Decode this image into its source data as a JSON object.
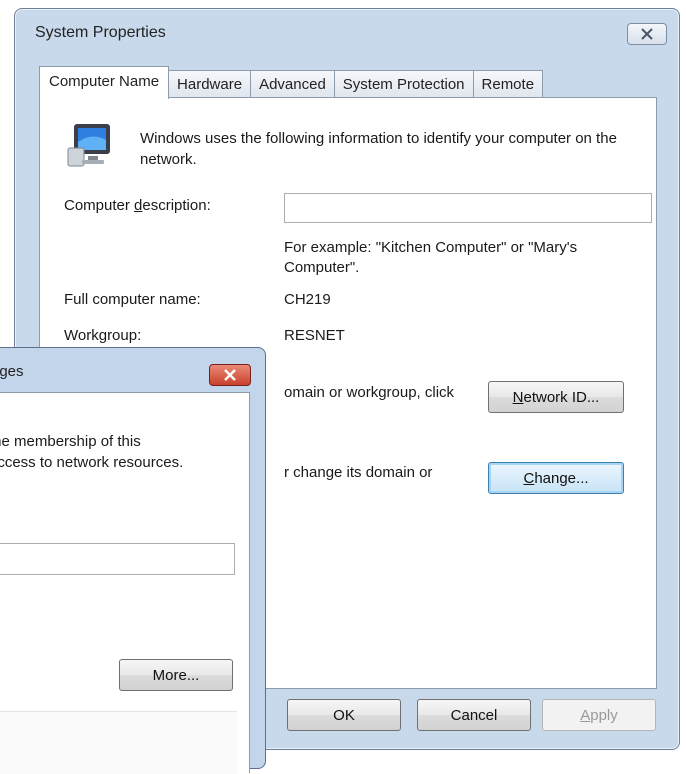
{
  "window": {
    "title": "System Properties",
    "tabs": [
      {
        "label": "Computer Name",
        "active": true
      },
      {
        "label": "Hardware",
        "active": false
      },
      {
        "label": "Advanced",
        "active": false
      },
      {
        "label": "System Protection",
        "active": false
      },
      {
        "label": "Remote",
        "active": false
      }
    ]
  },
  "computer_name_tab": {
    "intro_text": "Windows uses the following information to identify your computer on the network.",
    "description_label_pre": "Computer ",
    "description_label_accel": "d",
    "description_label_post": "escription:",
    "description_value": "",
    "example_text": "For example: \"Kitchen Computer\" or \"Mary's Computer\".",
    "full_name_label": "Full computer name:",
    "full_name_value": "CH219",
    "workgroup_label": "Workgroup:",
    "workgroup_value": "RESNET",
    "network_id_text": "omain or workgroup, click",
    "network_id_btn_accel": "N",
    "network_id_btn_rest": "etwork ID...",
    "change_text": "r change its domain or",
    "change_btn_accel": "C",
    "change_btn_rest": "hange..."
  },
  "footer": {
    "ok_label": "OK",
    "cancel_label": "Cancel",
    "apply_accel": "A",
    "apply_rest": "pply"
  },
  "changes_dialog": {
    "title": "nges",
    "text_line1": "the membership of this",
    "text_line2": " access to network resources.",
    "input_value": "",
    "more_label": "More..."
  },
  "colors": {
    "window_frame": "#c9d9ec",
    "focus_border": "#3c7fb1",
    "close_red": "#c8412c"
  },
  "icons": {
    "computer": "computer-monitor-icon",
    "close": "close-x-icon"
  }
}
